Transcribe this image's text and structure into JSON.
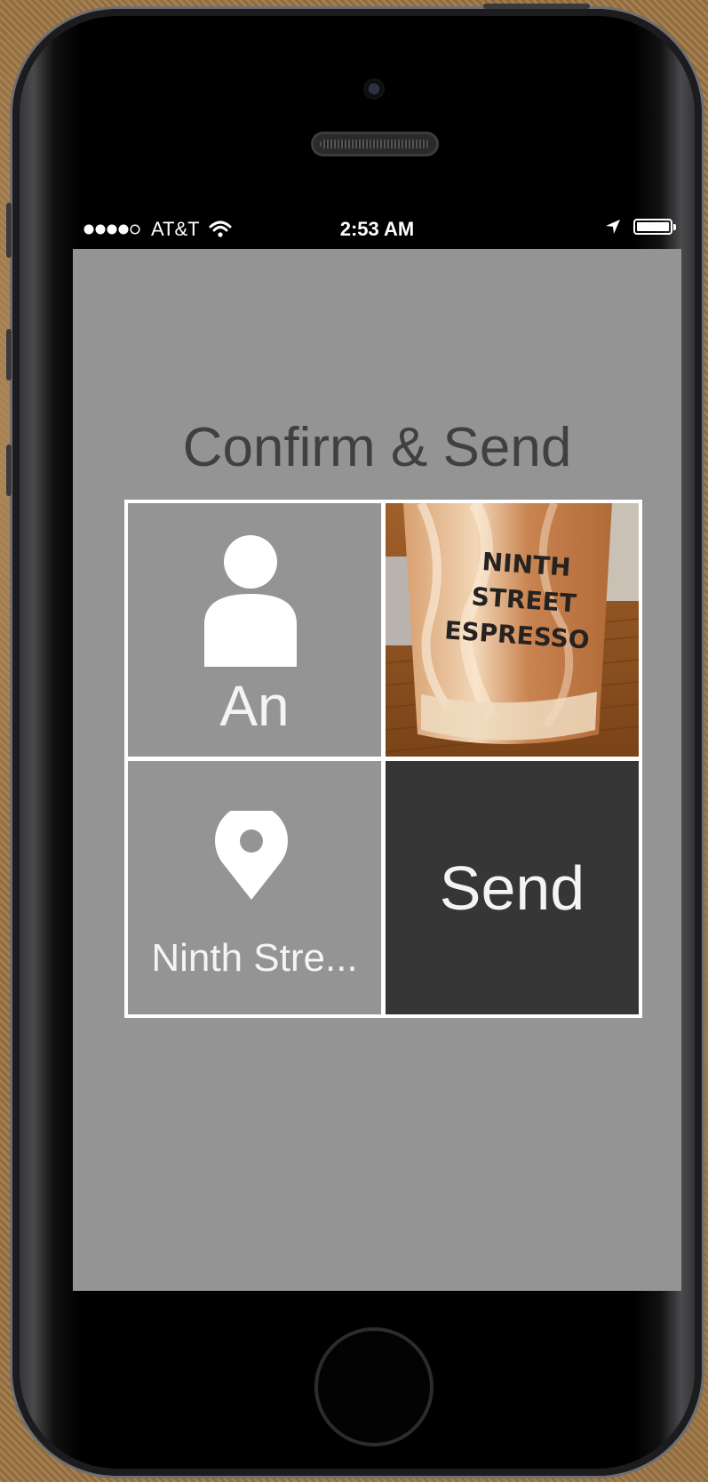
{
  "status_bar": {
    "carrier": "AT&T",
    "time": "2:53 AM",
    "signal_bars_filled": 4,
    "signal_bars_total": 5,
    "battery_level": 1.0
  },
  "screen": {
    "title": "Confirm & Send",
    "recipient": {
      "name": "An",
      "icon": "person-icon"
    },
    "photo": {
      "cup_text": [
        "NINTH",
        "STREET",
        "ESPRESSO"
      ]
    },
    "location": {
      "label": "Ninth Stre...",
      "icon": "location-pin-icon"
    },
    "send_label": "Send"
  },
  "colors": {
    "screen_background": "#949494",
    "send_tile": "#363636",
    "title_text": "#404040",
    "tile_text": "#f4f4f4"
  }
}
